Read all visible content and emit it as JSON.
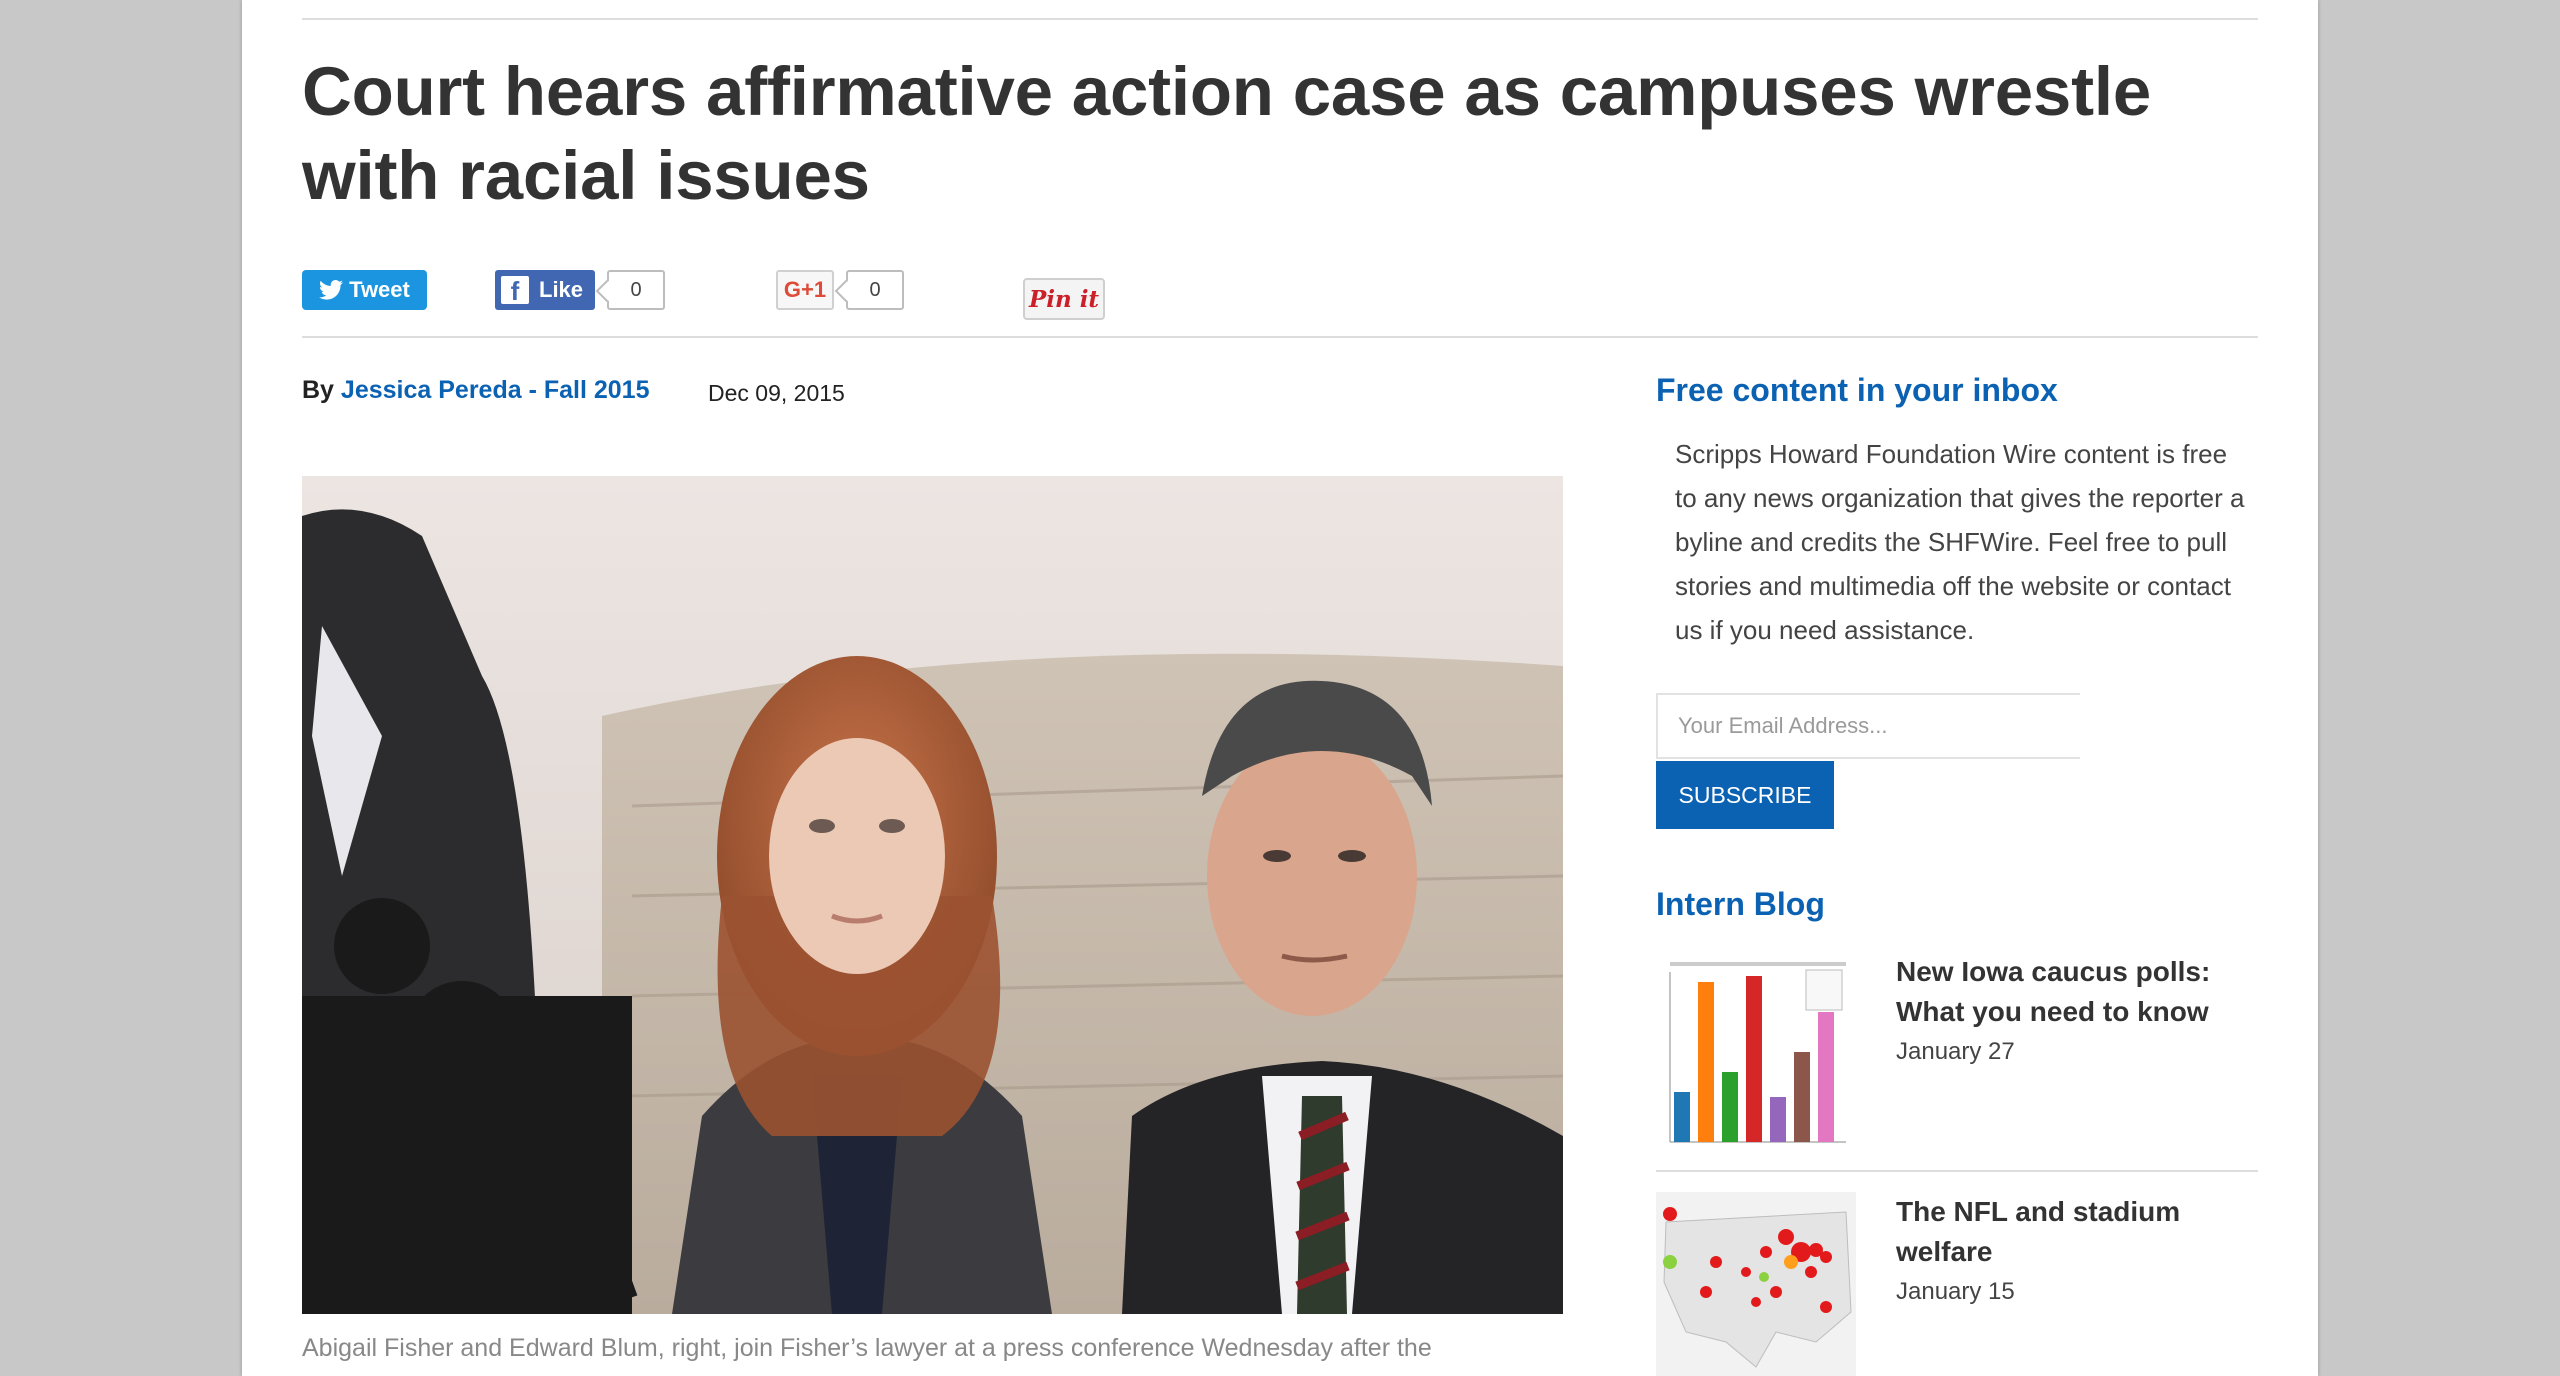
{
  "article": {
    "headline": "Court hears affirmative action case as campuses wrestle with racial issues",
    "byline_prefix": "By",
    "author": "Jessica Pereda - Fall 2015",
    "date": "Dec 09, 2015",
    "caption": "Abigail Fisher and Edward Blum, right, join Fisher’s lawyer at a press conference Wednesday after the"
  },
  "share": {
    "tweet_label": "Tweet",
    "like_label": "Like",
    "like_count": "0",
    "gplus_label": "G+1",
    "gplus_count": "0",
    "pin_label": "Pin it"
  },
  "sidebar": {
    "newsletter_title": "Free content in your inbox",
    "newsletter_text": "Scripps Howard Foundation Wire content is free to any news organization that gives the reporter a byline and credits the SHFWire. Feel free to pull stories and multimedia off the website or contact us if you need assistance.",
    "email_placeholder": "Your Email Address...",
    "subscribe_label": "SUBSCRIBE",
    "blog_title": "Intern Blog",
    "blog_items": [
      {
        "title": "New Iowa caucus polls: What you need to know",
        "date": "January 27"
      },
      {
        "title": "The NFL and stadium welfare",
        "date": "January 15"
      }
    ]
  },
  "colors": {
    "link_blue": "#0b62b3",
    "twitter": "#1b95e0",
    "facebook": "#4267b2",
    "pinterest": "#cb2027"
  }
}
